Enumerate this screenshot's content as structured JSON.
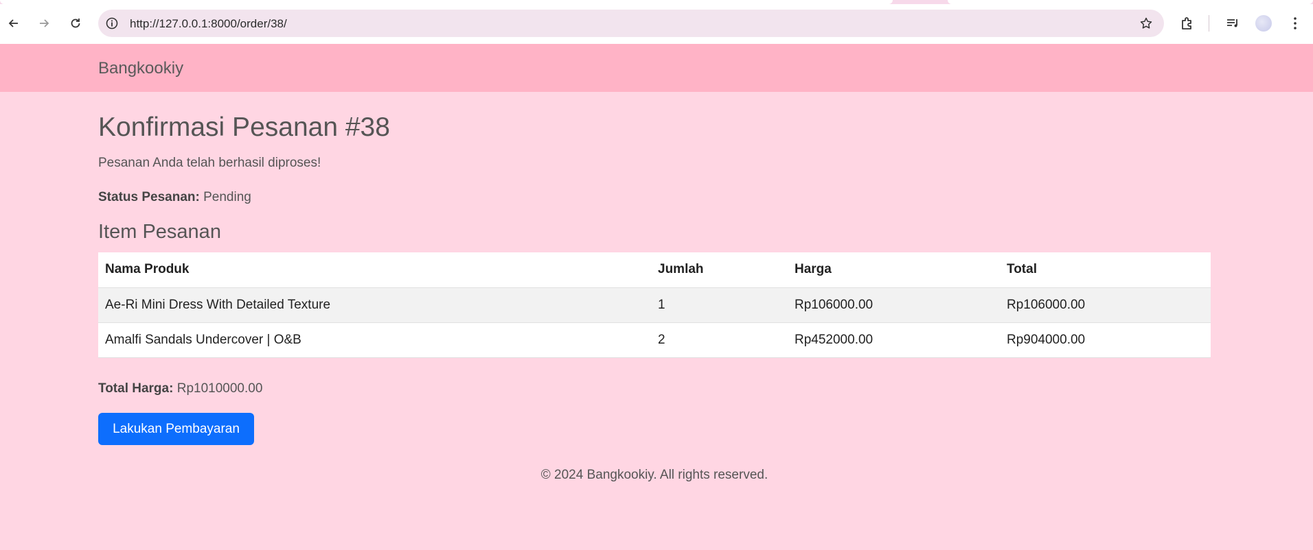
{
  "browser": {
    "url": "http://127.0.0.1:8000/order/38/",
    "icons": [
      "back-icon",
      "forward-icon",
      "reload-icon",
      "info-icon",
      "star-icon",
      "extensions-icon",
      "media-icon",
      "profile-avatar",
      "kebab-menu-icon"
    ]
  },
  "navbar": {
    "brand": "Bangkookiy"
  },
  "page": {
    "title": "Konfirmasi Pesanan #38",
    "success_message": "Pesanan Anda telah berhasil diproses!",
    "status_label": "Status Pesanan:",
    "status_value": "Pending",
    "items_heading": "Item Pesanan"
  },
  "table": {
    "headers": [
      "Nama Produk",
      "Jumlah",
      "Harga",
      "Total"
    ],
    "rows": [
      [
        "Ae-Ri Mini Dress With Detailed Texture",
        "1",
        "Rp106000.00",
        "Rp106000.00"
      ],
      [
        "Amalfi Sandals Undercover | O&B",
        "2",
        "Rp452000.00",
        "Rp904000.00"
      ]
    ]
  },
  "summary": {
    "total_label": "Total Harga:",
    "total_value": "Rp1010000.00"
  },
  "actions": {
    "pay_button": "Lakukan Pembayaran"
  },
  "footer": {
    "text": "© 2024 Bangkookiy. All rights reserved."
  },
  "colors": {
    "page_bg": "#ffd6e3",
    "navbar_bg": "#ffb3c6",
    "button_bg": "#0d6efd"
  }
}
